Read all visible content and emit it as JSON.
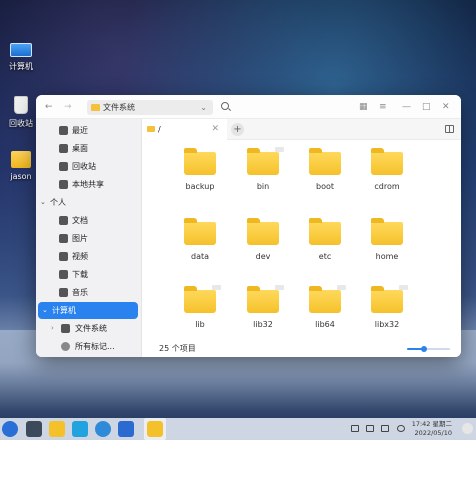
{
  "desktop": {
    "icons": [
      {
        "label": "计算机",
        "icon": "computer-icon"
      },
      {
        "label": "回收站",
        "icon": "trash-icon"
      },
      {
        "label": "jason",
        "icon": "home-folder-icon"
      }
    ]
  },
  "window": {
    "path": "文件系统",
    "tab_label": "/",
    "sidebar": {
      "recent": "最近",
      "desktop": "桌面",
      "trash": "回收站",
      "local_share": "本地共享",
      "personal_group": "个人",
      "documents": "文档",
      "pictures": "图片",
      "videos": "视频",
      "downloads": "下载",
      "music": "音乐",
      "computer_group": "计算机",
      "filesystem": "文件系统",
      "all_tags": "所有标记..."
    },
    "files": [
      {
        "name": "backup",
        "link": false
      },
      {
        "name": "bin",
        "link": true
      },
      {
        "name": "boot",
        "link": false
      },
      {
        "name": "cdrom",
        "link": false
      },
      {
        "name": "data",
        "link": false
      },
      {
        "name": "dev",
        "link": false
      },
      {
        "name": "etc",
        "link": false
      },
      {
        "name": "home",
        "link": false
      },
      {
        "name": "lib",
        "link": true
      },
      {
        "name": "lib32",
        "link": true
      },
      {
        "name": "lib64",
        "link": true
      },
      {
        "name": "libx32",
        "link": true
      }
    ],
    "status": {
      "count": "25 个项目",
      "zoom": 0.4
    }
  },
  "taskbar": {
    "time": "17:42 星期二",
    "date": "2022/05/10"
  },
  "colors": {
    "accent": "#2a82ef",
    "folder": "#f5c12a"
  }
}
